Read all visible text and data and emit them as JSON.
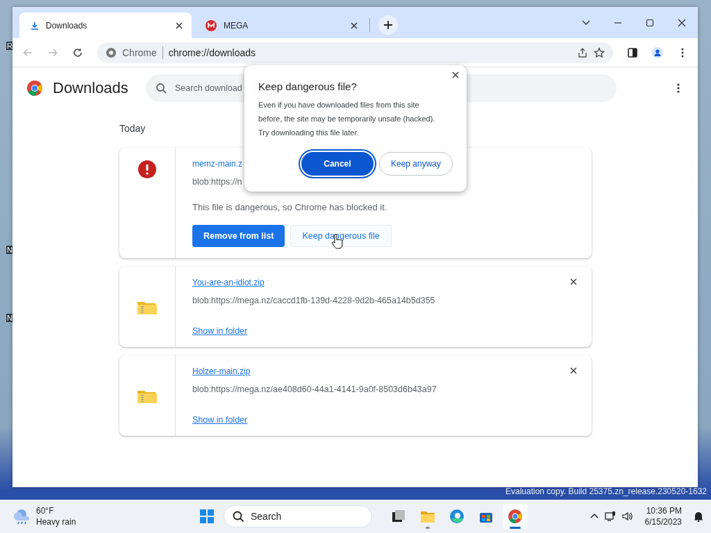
{
  "desktop": {
    "icon_labels": [
      "R",
      "N",
      "N"
    ],
    "watermark": "Evaluation copy. Build 25375.zn_release.230520-1632"
  },
  "browser": {
    "tabs": [
      {
        "title": "Downloads",
        "selected": true
      },
      {
        "title": "MEGA",
        "selected": false
      }
    ],
    "omnibox": {
      "site_chip": "Chrome",
      "url": "chrome://downloads"
    }
  },
  "page": {
    "title": "Downloads",
    "search": {
      "placeholder": "Search download"
    },
    "section": "Today",
    "downloads": [
      {
        "kind": "dangerous",
        "filename": "memz-main.z",
        "url": "blob:https://n",
        "warning": "This file is dangerous, so Chrome has blocked it.",
        "actions": [
          "Remove from list",
          "Keep dangerous file"
        ]
      },
      {
        "kind": "complete",
        "filename": "You-are-an-idiot.zip",
        "url": "blob:https://mega.nz/caccd1fb-139d-4228-9d2b-465a14b5d355",
        "link": "Show in folder"
      },
      {
        "kind": "complete",
        "filename": "Holzer-main.zip",
        "url": "blob:https://mega.nz/ae408d60-44a1-4141-9a0f-8503d6b43a97",
        "link": "Show in folder"
      }
    ]
  },
  "dialog": {
    "title": "Keep dangerous file?",
    "message": "Even if you have downloaded files from this site\nbefore, the site may be temporarily unsafe (hacked).\nTry downloading this file later.",
    "buttons": [
      {
        "label": "Cancel",
        "kind": "primary"
      },
      {
        "label": "Keep anyway",
        "kind": "secondary"
      }
    ]
  },
  "taskbar": {
    "weather": {
      "temperature": "60°F",
      "condition": "Heavy rain"
    },
    "search": {
      "placeholder": "Search"
    },
    "apps": [
      {
        "kind": "task-view",
        "running": false,
        "focused": false
      },
      {
        "kind": "folder",
        "running": true,
        "focused": false
      },
      {
        "kind": "edge",
        "running": false,
        "focused": false
      },
      {
        "kind": "store",
        "running": false,
        "focused": false
      },
      {
        "kind": "chrome",
        "running": true,
        "focused": true
      }
    ],
    "time": "10:36 PM",
    "date": "6/15/2023"
  }
}
